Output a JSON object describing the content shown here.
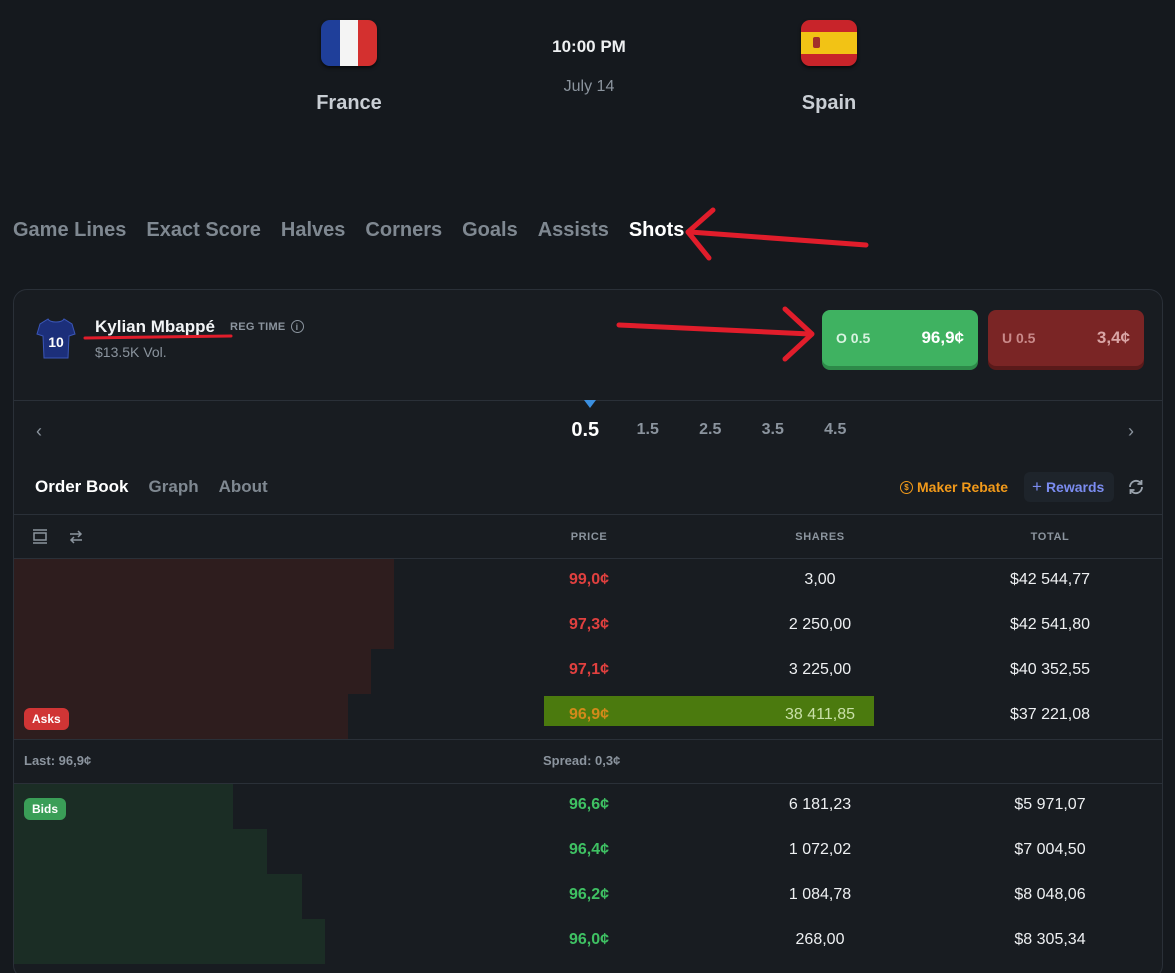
{
  "match": {
    "home_team": "France",
    "away_team": "Spain",
    "time": "10:00 PM",
    "date": "July 14"
  },
  "tabs": [
    {
      "label": "Game Lines"
    },
    {
      "label": "Exact Score"
    },
    {
      "label": "Halves"
    },
    {
      "label": "Corners"
    },
    {
      "label": "Goals"
    },
    {
      "label": "Assists"
    },
    {
      "label": "Shots",
      "active": true
    }
  ],
  "market": {
    "player_name": "Kylian Mbappé",
    "jersey_number": "10",
    "reg_time": "REG TIME",
    "volume": "$13.5K Vol.",
    "over": {
      "label": "O 0.5",
      "price": "96,9¢"
    },
    "under": {
      "label": "U 0.5",
      "price": "3,4¢"
    }
  },
  "lines": {
    "options": [
      "0.5",
      "1.5",
      "2.5",
      "3.5",
      "4.5"
    ],
    "selected": "0.5"
  },
  "subtabs": [
    "Order Book",
    "Graph",
    "About"
  ],
  "maker_rebate": "Maker Rebate",
  "rewards": "Rewards",
  "columns": {
    "price": "PRICE",
    "shares": "SHARES",
    "total": "TOTAL"
  },
  "asks": [
    {
      "price": "99,0¢",
      "shares": "3,00",
      "total": "$42 544,77",
      "depth": 0.33
    },
    {
      "price": "97,3¢",
      "shares": "2 250,00",
      "total": "$42 541,80",
      "depth": 0.33
    },
    {
      "price": "97,1¢",
      "shares": "3 225,00",
      "total": "$40 352,55",
      "depth": 0.31
    },
    {
      "price": "96,9¢",
      "shares": "38 411,85",
      "total": "$37 221,08",
      "depth": 0.29
    }
  ],
  "asks_badge": "Asks",
  "last": "Last: 96,9¢",
  "spread": "Spread: 0,3¢",
  "bids_badge": "Bids",
  "bids": [
    {
      "price": "96,6¢",
      "shares": "6 181,23",
      "total": "$5 971,07",
      "depth": 0.19
    },
    {
      "price": "96,4¢",
      "shares": "1 072,02",
      "total": "$7 004,50",
      "depth": 0.22
    },
    {
      "price": "96,2¢",
      "shares": "1 084,78",
      "total": "$8 048,06",
      "depth": 0.25
    },
    {
      "price": "96,0¢",
      "shares": "268,00",
      "total": "$8 305,34",
      "depth": 0.27
    }
  ],
  "colors": {
    "background": "#15191e",
    "over_green": "#3fb261",
    "under_red": "#7a2525",
    "ask_red": "#e0403f",
    "bid_green": "#3fc163",
    "annotation_red": "#e11d2b",
    "highlight": "#4b7a0e"
  }
}
